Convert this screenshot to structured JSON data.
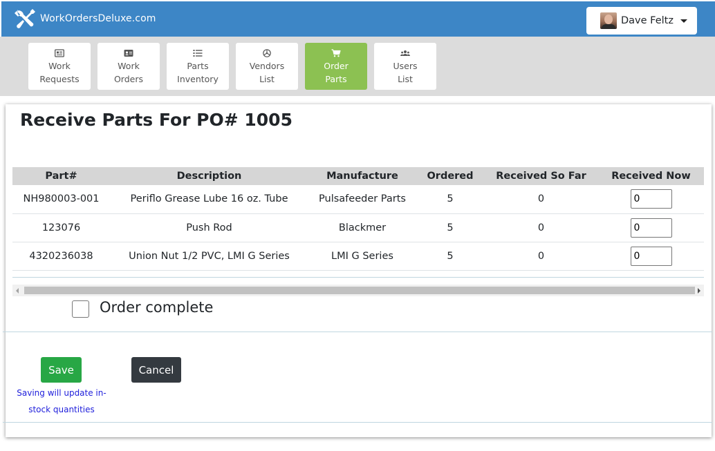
{
  "header": {
    "brand": "WorkOrdersDeluxe.com",
    "user_name": "Dave Feltz"
  },
  "nav": {
    "items": [
      {
        "line1": "Work",
        "line2": "Requests",
        "icon": "newspaper-icon",
        "active": false
      },
      {
        "line1": "Work",
        "line2": "Orders",
        "icon": "id-card-icon",
        "active": false
      },
      {
        "line1": "Parts",
        "line2": "Inventory",
        "icon": "list-icon",
        "active": false
      },
      {
        "line1": "Vendors",
        "line2": "List",
        "icon": "steering-icon",
        "active": false
      },
      {
        "line1": "Order",
        "line2": "Parts",
        "icon": "cart-icon",
        "active": true
      },
      {
        "line1": "Users",
        "line2": "List",
        "icon": "users-icon",
        "active": false
      }
    ]
  },
  "page": {
    "title": "Receive Parts For PO# 1005"
  },
  "table": {
    "headers": [
      "Part#",
      "Description",
      "Manufacture",
      "Ordered",
      "Received So Far",
      "Received Now"
    ],
    "rows": [
      {
        "part": "NH980003-001",
        "description": "Periflo Grease Lube 16 oz. Tube",
        "manufacture": "Pulsafeeder Parts",
        "ordered": "5",
        "received_so_far": "0",
        "received_now": "0"
      },
      {
        "part": "123076",
        "description": "Push Rod",
        "manufacture": "Blackmer",
        "ordered": "5",
        "received_so_far": "0",
        "received_now": "0"
      },
      {
        "part": "4320236038",
        "description": "Union Nut 1/2 PVC, LMI G Series",
        "manufacture": "LMI G Series",
        "ordered": "5",
        "received_so_far": "0",
        "received_now": "0"
      }
    ]
  },
  "form": {
    "order_complete_label": "Order complete",
    "save_label": "Save",
    "cancel_label": "Cancel",
    "save_note": "Saving will update in-stock quantities"
  },
  "colors": {
    "header_bg": "#3d86c6",
    "nav_bg": "#dcdcdc",
    "nav_active": "#8cc152",
    "save": "#28a745",
    "cancel": "#343a40",
    "note_text": "#1d1ddb"
  }
}
